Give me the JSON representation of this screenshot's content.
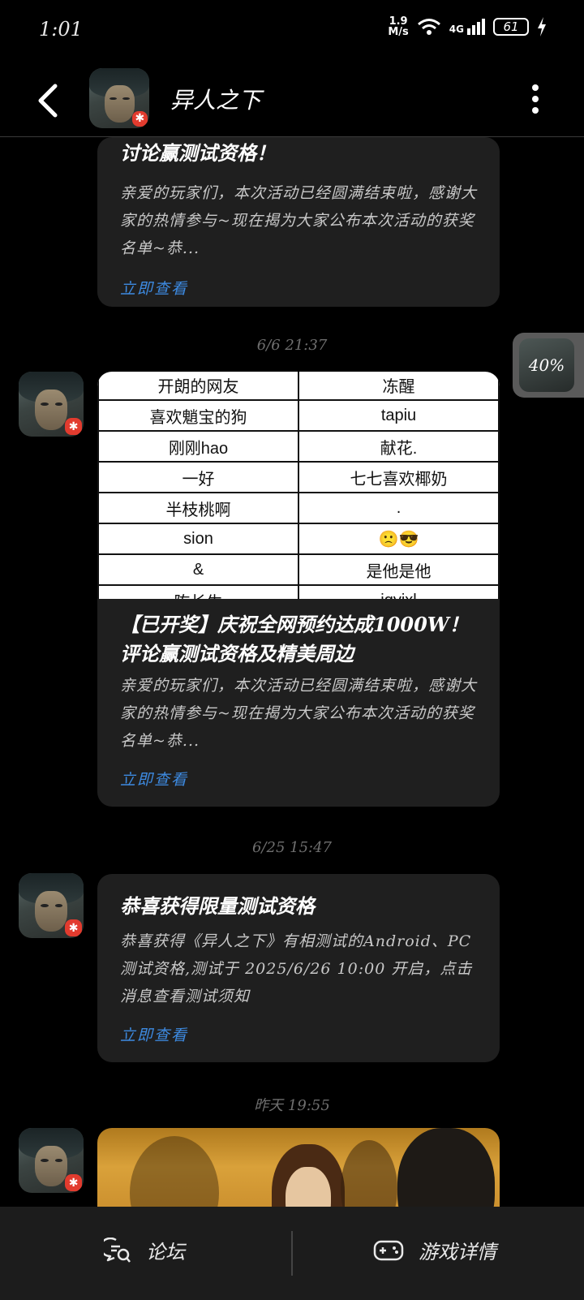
{
  "status": {
    "time": "1:01",
    "speed": "1.9",
    "speed_unit": "M/s",
    "network": "4G",
    "battery": "61"
  },
  "header": {
    "title": "异人之下"
  },
  "messages": [
    {
      "title": "讨论赢测试资格！",
      "body": "亲爱的玩家们，本次活动已经圆满结束啦，感谢大家的热情参与~现在揭为大家公布本次活动的获奖名单~恭...",
      "link": "立即查看"
    },
    {
      "timestamp": "6/6 21:37",
      "table": [
        [
          "开朗的网友",
          "冻醒"
        ],
        [
          "喜欢魈宝的狗",
          "tapiu"
        ],
        [
          "刚刚hao",
          "献花."
        ],
        [
          "一好",
          "七七喜欢椰奶"
        ],
        [
          "半枝桃啊",
          "."
        ],
        [
          "sion",
          "🙁😎"
        ],
        [
          "&",
          "是他是他"
        ],
        [
          "陈长生",
          "jqyixl"
        ]
      ],
      "title": "【已开奖】庆祝全网预约达成1000W！评论赢测试资格及精美周边",
      "body": "亲爱的玩家们，本次活动已经圆满结束啦，感谢大家的热情参与~现在揭为大家公布本次活动的获奖名单~恭...",
      "link": "立即查看"
    },
    {
      "timestamp": "6/25 15:47",
      "title": "恭喜获得限量测试资格",
      "body": "恭喜获得《异人之下》有相测试的Android、PC测试资格,测试于 2025/6/26 10:00 开启，点击消息查看测试须知",
      "link": "立即查看"
    },
    {
      "timestamp": "昨天 19:55"
    }
  ],
  "float_progress": "40%",
  "bottom_nav": {
    "forum": "论坛",
    "game_details": "游戏详情"
  }
}
